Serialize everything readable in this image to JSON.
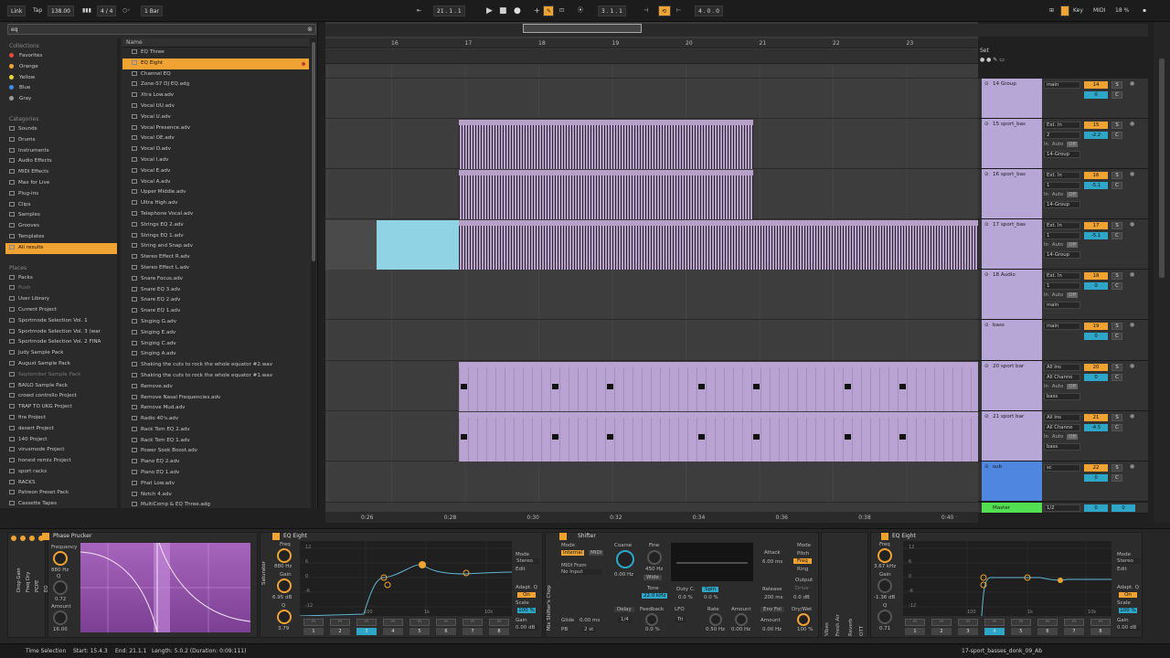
{
  "topbar": {
    "link": "Link",
    "tap": "Tap",
    "tempo": "138.00",
    "sig": "4 / 4",
    "quant": "1 Bar",
    "position": "21 . 1 . 1",
    "loop_start": "3 . 1 . 1",
    "loop_len": "4 . 0 . 0",
    "key": "Key",
    "midi": "MIDI",
    "cpu": "18 %"
  },
  "browser": {
    "search_value": "eq",
    "collections_head": "Collections",
    "collections": [
      {
        "label": "Favorites",
        "color": "#e84a3a"
      },
      {
        "label": "Orange",
        "color": "#f0a332"
      },
      {
        "label": "Yellow",
        "color": "#e8d73a"
      },
      {
        "label": "Blue",
        "color": "#3a8de8"
      },
      {
        "label": "Gray",
        "color": "#9a9a9a"
      }
    ],
    "categories_head": "Categories",
    "categories": [
      "Sounds",
      "Drums",
      "Instruments",
      "Audio Effects",
      "MIDI Effects",
      "Max for Live",
      "Plug-ins",
      "Clips",
      "Samples",
      "Grooves",
      "Templates",
      "All results"
    ],
    "places_head": "Places",
    "places": [
      "Packs",
      "Push",
      "User Library",
      "Current Project",
      "Sportmode Selection Vol. 1",
      "Sportmode Selection Vol. 3 (war",
      "Sportmode Selection Vol. 2 FINA",
      "Judy Sample Pack",
      "August Sample Pack",
      "September Sample Pack",
      "BAILO Sample Pack",
      "crowd controllo Project",
      "TRAP TO UKG Project",
      "fire Project",
      "desert Project",
      "140 Project",
      "virusmode Project",
      "honest remix Project",
      "sport racks",
      "RACKS",
      "Patreon Preset Pack",
      "Cassette Tapes"
    ],
    "name_head": "Name",
    "files": [
      "EQ Three",
      "EQ Eight",
      "Channel EQ",
      "Zone-S7 DJ EQ.adg",
      "Xtra Low.adv",
      "Vocal UU.adv",
      "Vocal U.adv",
      "Vocal Presence.adv",
      "Vocal OE.adv",
      "Vocal O.adv",
      "Vocal I.adv",
      "Vocal E.adv",
      "Vocal A.adv",
      "Upper Middle.adv",
      "Ultra High.adv",
      "Telephone Vocal.adv",
      "Strings EQ 2.adv",
      "Strings EQ 1.adv",
      "String and Snap.adv",
      "Stereo Effect R.adv",
      "Stereo Effect L.adv",
      "Snare Focus.adv",
      "Snare EQ 3.adv",
      "Snare EQ 2.adv",
      "Snare EQ 1.adv",
      "Singing G.adv",
      "Singing E.adv",
      "Singing C.adv",
      "Singing A.adv",
      "Shaking the cuts to rock the whole equator #2.wav",
      "Shaking the cuts to rock the whole equator #1.wav",
      "Remove.adv",
      "Remove Nasal Frequencies.adv",
      "Remove Mud.adv",
      "Radio 40's.adv",
      "Rack Tom EQ 2.adv",
      "Rack Tom EQ 1.adv",
      "Power Sook Boost.adv",
      "Piano EQ 2.adv",
      "Piano EQ 1.adv",
      "Phat Low.adv",
      "Notch 4.adv",
      "MultiComp & EQ Three.adg"
    ]
  },
  "arrangement": {
    "bars": [
      "16",
      "17",
      "18",
      "19",
      "20",
      "21",
      "22",
      "23"
    ],
    "times": [
      "0:26",
      "0:28",
      "0:30",
      "0:32",
      "0:34",
      "0:36",
      "0:38",
      "0:40"
    ]
  },
  "mixer": {
    "set_label": "Set",
    "tracks": [
      {
        "name": "14 Group",
        "io1": "main",
        "num": "14",
        "pan": "0",
        "s": "S",
        "c": "C"
      },
      {
        "name": "15 sport_bas",
        "io1": "Ext. In",
        "io2": "2",
        "io3": "14-Group",
        "num": "15",
        "pan": "-2.2",
        "s": "S",
        "c": "C"
      },
      {
        "name": "16 sport_bas",
        "io1": "Ext. In",
        "io2": "1",
        "io3": "14-Group",
        "num": "16",
        "pan": "-5.1",
        "s": "S",
        "c": "C"
      },
      {
        "name": "17 sport_bas",
        "io1": "Ext. In",
        "io2": "1",
        "io3": "14-Group",
        "num": "17",
        "pan": "-5.1",
        "s": "S",
        "c": "C"
      },
      {
        "name": "18 Audio",
        "io1": "Ext. In",
        "io2": "1",
        "io3": "main",
        "num": "18",
        "pan": "0",
        "s": "S",
        "c": "C"
      },
      {
        "name": "bass",
        "io1": "main",
        "num": "19",
        "pan": "0",
        "s": "S",
        "c": "C"
      },
      {
        "name": "20 sport bar",
        "io1": "All Ins",
        "io2": "All Channe",
        "io3": "bass",
        "num": "20",
        "pan": "0",
        "s": "S",
        "c": "C"
      },
      {
        "name": "21 sport bar",
        "io1": "All Ins",
        "io2": "All Channe",
        "io3": "bass",
        "num": "21",
        "pan": "-4.5",
        "s": "S",
        "c": "C"
      },
      {
        "name": "sub",
        "io1": "sc",
        "num": "22",
        "pan": "0",
        "s": "S",
        "c": "C"
      }
    ],
    "master": {
      "name": "Master",
      "io1": "1/2",
      "num": "0",
      "pan": "0"
    },
    "in_label": "In",
    "auto_label": "Auto",
    "off_label": "Off"
  },
  "devices": {
    "phase": {
      "title": "Phase Prucker",
      "freq_label": "Frequency",
      "freq": "880 Hz",
      "q_label": "Q",
      "q": "0.72",
      "amount_label": "Amount",
      "amount": "16.00"
    },
    "eq1": {
      "title": "EQ Eight",
      "freq_label": "Freq",
      "freq": "880 Hz",
      "gain_label": "Gain",
      "gain": "6.95 dB",
      "q_label": "Q",
      "q": "3.79",
      "mode_label": "Mode",
      "mode": "Stereo",
      "edit": "Edit",
      "adapt": "Adapt. Q",
      "on": "On",
      "scale_label": "Scale",
      "scale": "100 %",
      "gain2_label": "Gain",
      "gain2": "0.00 dB",
      "saturator": "Saturator",
      "db": [
        "12",
        "6",
        "0",
        "-6",
        "-12"
      ],
      "hz": [
        "100",
        "1k",
        "10k"
      ]
    },
    "shifter": {
      "title": "Shifter",
      "mode_label": "Mode",
      "internal": "Internal",
      "midi": "MIDI",
      "midi_from": "MIDI From",
      "no_input": "No Input",
      "coarse_label": "Coarse",
      "coarse": "0.00 Hz",
      "fine_label": "Fine",
      "fine": "450 Hz",
      "wide": "Wide",
      "tone_label": "Tone",
      "tone": "22.0 kHz",
      "glide_label": "Glide",
      "glide": "0.00 ms",
      "pb_label": "PB",
      "pb": "2 st",
      "delay_label": "Delay",
      "delay": "1/4",
      "feedback_label": "Feedback",
      "feedback": "0.0 %",
      "lfo_label": "LFO",
      "lfo": "Tri",
      "duty_label": "Duty C.",
      "duty": "0.0 %",
      "spin_label": "Spin",
      "spin": "0.0 %",
      "rate_label": "Rate",
      "rate": "0.50 Hz",
      "lfo_amount_label": "Amount",
      "lfo_amount": "0.00 Hz",
      "attack_label": "Attack",
      "attack": "6.00 ms",
      "release_label": "Release",
      "release": "200 ms",
      "envfol": "Env Fol",
      "amount_label": "Amount",
      "amount": "0.00 Hz",
      "mode2_label": "Mode",
      "pitch": "Pitch",
      "freq": "Freq",
      "ring": "Ring",
      "output_label": "Output",
      "drive": "Drive",
      "output": "0.0 dB",
      "drywet_label": "Dry/Wet",
      "drywet": "100 %",
      "amount2": "Amount",
      "side_label": "Mix Shifter's Chop",
      "vibes": "Vibes",
      "freshair": "Fresh Air",
      "reverb": "Reverb",
      "ott": "OTT"
    },
    "eq2": {
      "title": "EQ Eight",
      "freq_label": "Freq",
      "freq": "3.67 kHz",
      "gain_label": "Gain",
      "gain": "-1.36 dB",
      "q_label": "Q",
      "q": "0.71",
      "mode_label": "Mode",
      "mode": "Stereo",
      "edit": "Edit",
      "adapt": "Adapt. Q",
      "on": "On",
      "scale_label": "Scale",
      "scale": "100 %",
      "gain2_label": "Gain",
      "gain2": "0.00 dB",
      "db": [
        "12",
        "6",
        "0",
        "-6",
        "-12"
      ],
      "hz": [
        "100",
        "1k",
        "10k"
      ]
    },
    "side_labels": [
      "Drop Gain",
      "Freq Dry",
      "PCPE",
      "EQ"
    ]
  },
  "status": {
    "left": "Time Selection",
    "start": "Start: 15.4.3",
    "end": "End: 21.1.1",
    "length": "Length: 5.0.2 (Duration: 0:09:111)",
    "right": "17-sport_basses_donk_09_Ab"
  }
}
